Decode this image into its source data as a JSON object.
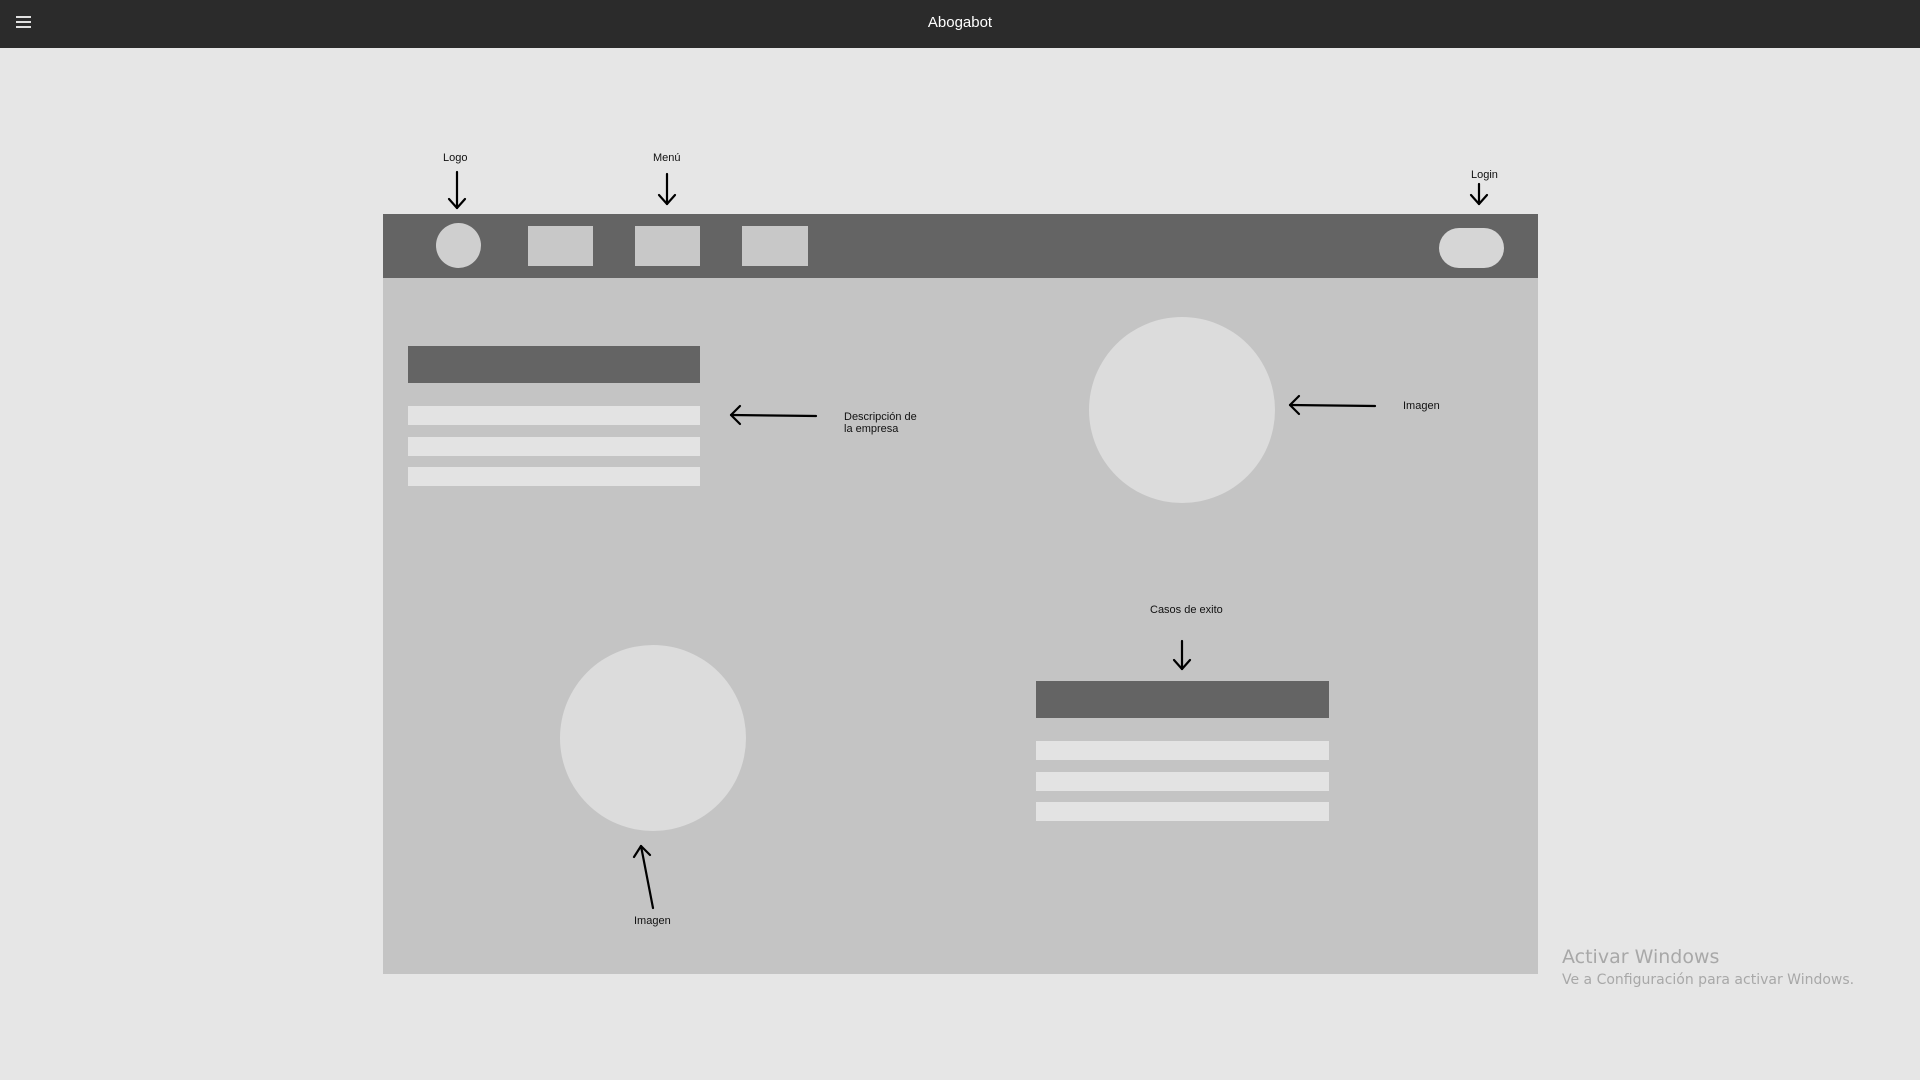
{
  "window": {
    "title": "Abogabot",
    "menu_icon": "hamburger-icon"
  },
  "wireframe": {
    "annotations": {
      "logo": "Logo",
      "menu": "Menú",
      "login": "Login",
      "description_line1": "Descripción de",
      "description_line2": "la empresa",
      "image_top": "Imagen",
      "success_cases": "Casos de exito",
      "image_bottom": "Imagen"
    }
  },
  "watermark": {
    "title": "Activar Windows",
    "subtitle": "Ve a Configuración para activar Windows."
  }
}
